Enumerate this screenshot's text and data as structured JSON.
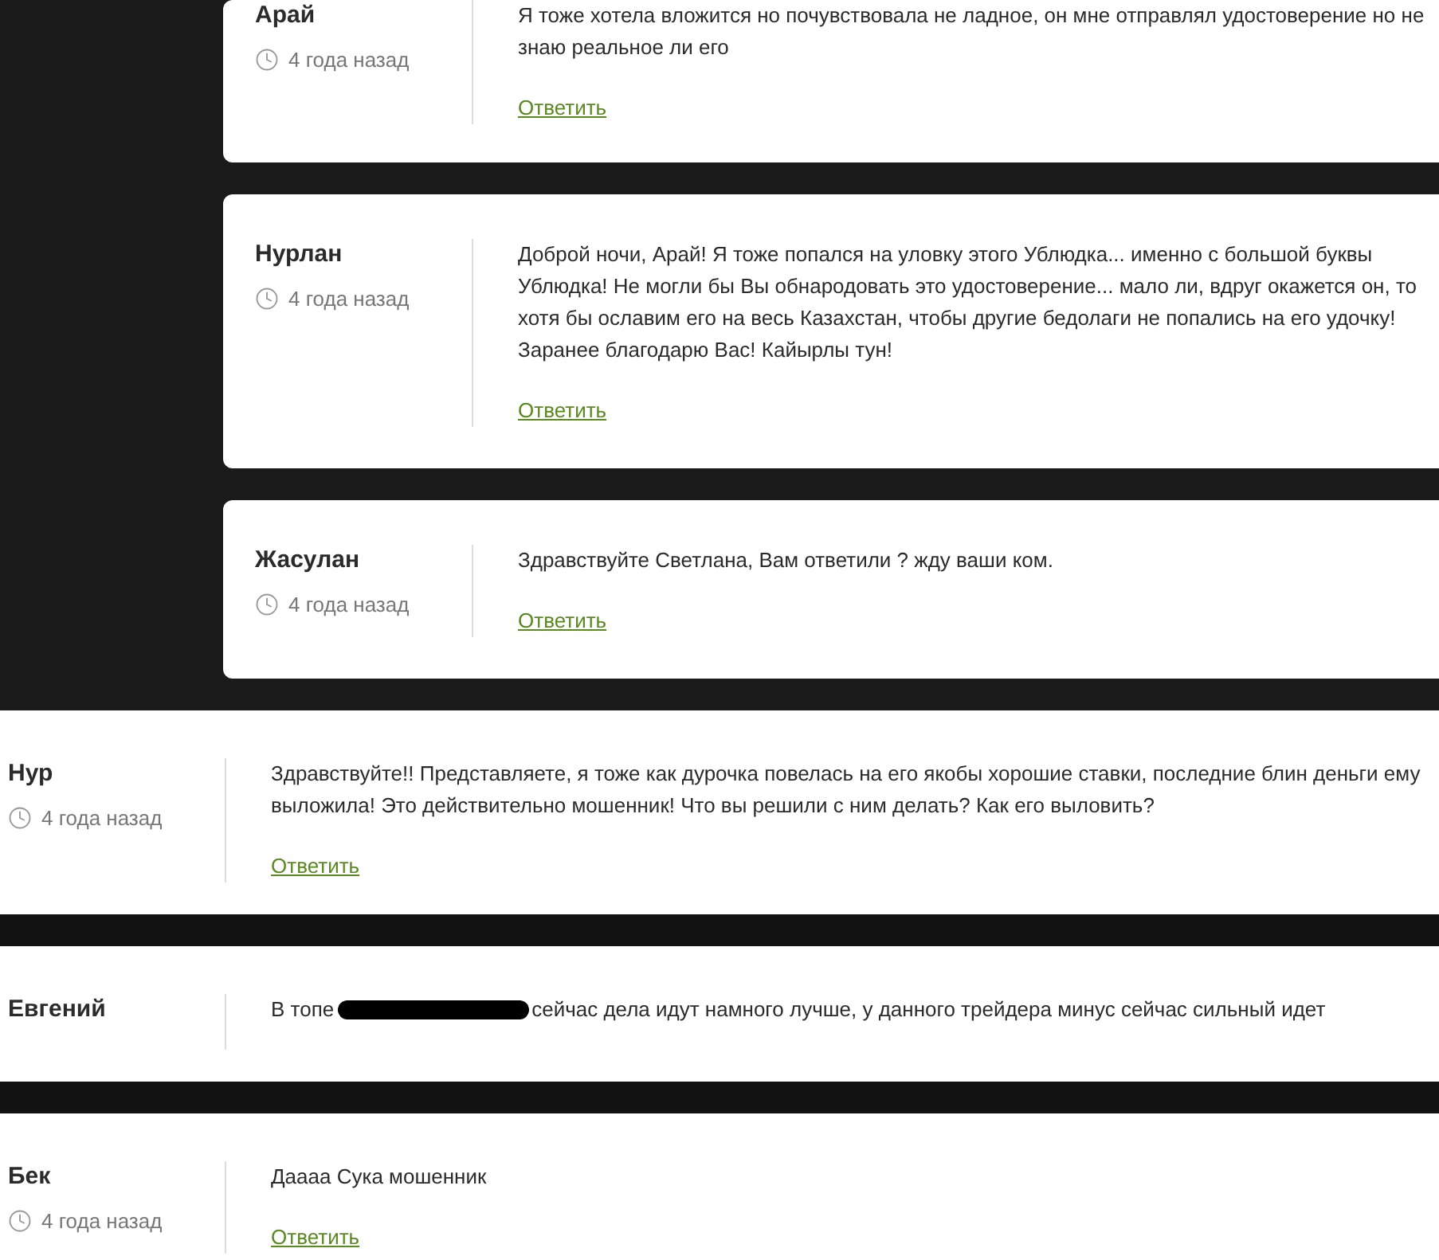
{
  "comments": [
    {
      "kind": "reply",
      "name": "Арай",
      "time": "4 года назад",
      "text": "Я тоже хотела вложится но почувствовала не ладное, он мне отправлял удостоверение но не знаю реальное ли его",
      "reply": "Ответить"
    },
    {
      "kind": "reply",
      "name": "Нурлан",
      "time": "4 года назад",
      "text": "Доброй ночи, Арай! Я тоже попался на уловку этого Ублюдка... именно с большой буквы Ублюдка! Не могли бы Вы обнародовать это удостоверение... мало ли, вдруг окажется он, то хотя бы ославим его на весь Казахстан, чтобы другие бедолаги не попались на его удочку! Заранее благодарю Вас! Кайырлы тун!",
      "reply": "Ответить"
    },
    {
      "kind": "reply",
      "name": "Жасулан",
      "time": "4 года назад",
      "text": "Здравствуйте Светлана, Вам ответили ? жду ваши ком.",
      "reply": "Ответить"
    },
    {
      "kind": "top",
      "name": "Нур",
      "time": "4 года назад",
      "text": "Здравствуйте!! Представляете, я тоже как дурочка повелась на его якобы хорошие ставки, последние блин деньги ему выложила! Это действительно мошенник! Что вы решили с ним делать? Как его выловить?",
      "reply": "Ответить"
    },
    {
      "kind": "top",
      "name": "Евгений",
      "text": "В топе",
      "redacted": true,
      "text_after": "сейчас дела идут намного лучше, у данного трейдера минус сейчас сильный идет"
    },
    {
      "kind": "top",
      "name": "Бек",
      "time": "4 года назад",
      "text": "Даааа Сука мошенник",
      "reply": "Ответить"
    }
  ]
}
